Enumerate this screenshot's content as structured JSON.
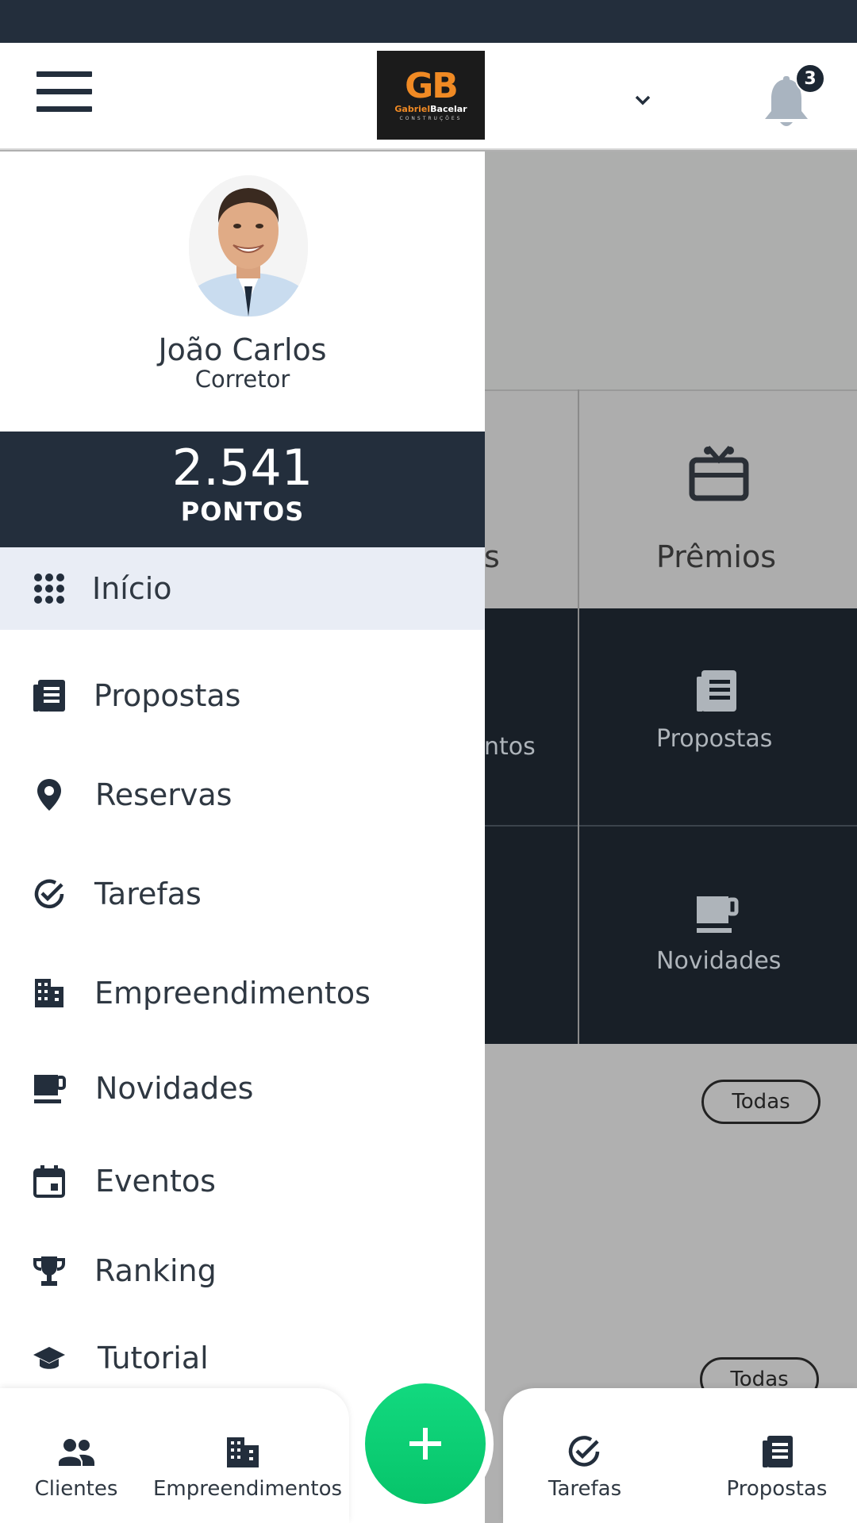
{
  "header": {
    "logo_mark": "GB",
    "logo_name_part1": "Gabriel",
    "logo_name_part2": "Bacelar",
    "logo_sub": "CONSTRUÇÕES",
    "notification_count": "3"
  },
  "background": {
    "card_partial_label": "s",
    "premios_label": "Prêmios",
    "partial_dark_label": "ntos",
    "propostas_label": "Propostas",
    "novidades_label": "Novidades",
    "todas_1": "Todas",
    "todas_2": "Todas"
  },
  "drawer": {
    "user_name": "João Carlos",
    "user_role": "Corretor",
    "points_value": "2.541",
    "points_label": "PONTOS",
    "menu": [
      {
        "label": "Início",
        "icon": "grid-icon"
      },
      {
        "label": "Propostas",
        "icon": "document-list-icon"
      },
      {
        "label": "Reservas",
        "icon": "location-pin-icon"
      },
      {
        "label": "Tarefas",
        "icon": "check-circle-icon"
      },
      {
        "label": "Empreendimentos",
        "icon": "building-icon"
      },
      {
        "label": "Novidades",
        "icon": "coffee-cup-icon"
      },
      {
        "label": "Eventos",
        "icon": "calendar-icon"
      },
      {
        "label": "Ranking",
        "icon": "trophy-icon"
      },
      {
        "label": "Tutorial",
        "icon": "graduation-cap-icon"
      }
    ]
  },
  "bottom_nav": {
    "clientes": "Clientes",
    "empreendimentos": "Empreendimentos",
    "tarefas": "Tarefas",
    "propostas": "Propostas",
    "fab_symbol": "+"
  },
  "colors": {
    "primary_dark": "#232e3c",
    "accent_green": "#07c46a",
    "logo_orange": "#f08a24",
    "active_item_bg": "#e9edf5"
  }
}
